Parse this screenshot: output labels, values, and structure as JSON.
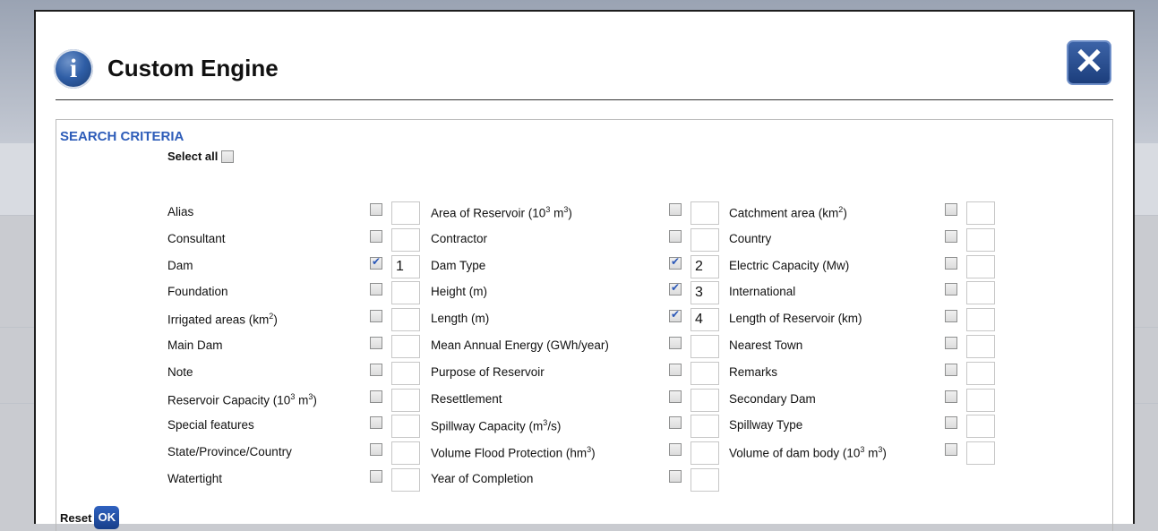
{
  "dialog": {
    "title": "Custom Engine",
    "close_symbol": "✕",
    "info_symbol": "i"
  },
  "criteria": {
    "heading": "SEARCH CRITERIA",
    "select_all_label": "Select all",
    "fields": [
      [
        {
          "label": "Alias",
          "checked": false,
          "order": ""
        },
        {
          "label": "Area of Reservoir (10<sup>3</sup> m<sup>3</sup>)",
          "checked": false,
          "order": ""
        },
        {
          "label": "Catchment area (km<sup>2</sup>)",
          "checked": false,
          "order": ""
        }
      ],
      [
        {
          "label": "Consultant",
          "checked": false,
          "order": ""
        },
        {
          "label": "Contractor",
          "checked": false,
          "order": ""
        },
        {
          "label": "Country",
          "checked": false,
          "order": ""
        }
      ],
      [
        {
          "label": "Dam",
          "checked": true,
          "order": "1"
        },
        {
          "label": "Dam Type",
          "checked": true,
          "order": "2"
        },
        {
          "label": "Electric Capacity (Mw)",
          "checked": false,
          "order": ""
        }
      ],
      [
        {
          "label": "Foundation",
          "checked": false,
          "order": ""
        },
        {
          "label": "Height (m)",
          "checked": true,
          "order": "3"
        },
        {
          "label": "International",
          "checked": false,
          "order": ""
        }
      ],
      [
        {
          "label": "Irrigated areas (km<sup>2</sup>)",
          "checked": false,
          "order": ""
        },
        {
          "label": "Length (m)",
          "checked": true,
          "order": "4"
        },
        {
          "label": "Length of Reservoir (km)",
          "checked": false,
          "order": ""
        }
      ],
      [
        {
          "label": "Main Dam",
          "checked": false,
          "order": ""
        },
        {
          "label": "Mean Annual Energy (GWh/year)",
          "checked": false,
          "order": ""
        },
        {
          "label": "Nearest Town",
          "checked": false,
          "order": ""
        }
      ],
      [
        {
          "label": "Note",
          "checked": false,
          "order": ""
        },
        {
          "label": "Purpose of Reservoir",
          "checked": false,
          "order": ""
        },
        {
          "label": "Remarks",
          "checked": false,
          "order": ""
        }
      ],
      [
        {
          "label": "Reservoir Capacity (10<sup>3</sup> m<sup>3</sup>)",
          "checked": false,
          "order": ""
        },
        {
          "label": "Resettlement",
          "checked": false,
          "order": ""
        },
        {
          "label": "Secondary Dam",
          "checked": false,
          "order": ""
        }
      ],
      [
        {
          "label": "Special features",
          "checked": false,
          "order": ""
        },
        {
          "label": "Spillway Capacity (m<sup>3</sup>/s)",
          "checked": false,
          "order": ""
        },
        {
          "label": "Spillway Type",
          "checked": false,
          "order": ""
        }
      ],
      [
        {
          "label": "State/Province/Country",
          "checked": false,
          "order": ""
        },
        {
          "label": "Volume Flood Protection (hm<sup>3</sup>)",
          "checked": false,
          "order": ""
        },
        {
          "label": "Volume of dam body (10<sup>3</sup> m<sup>3</sup>)",
          "checked": false,
          "order": ""
        }
      ],
      [
        {
          "label": "Watertight",
          "checked": false,
          "order": ""
        },
        {
          "label": "Year of Completion",
          "checked": false,
          "order": ""
        },
        null
      ]
    ]
  },
  "footer": {
    "reset_label": "Reset",
    "ok_label": "OK"
  },
  "colors": {
    "heading": "#2e5db9",
    "button": "#1c3e7c"
  }
}
